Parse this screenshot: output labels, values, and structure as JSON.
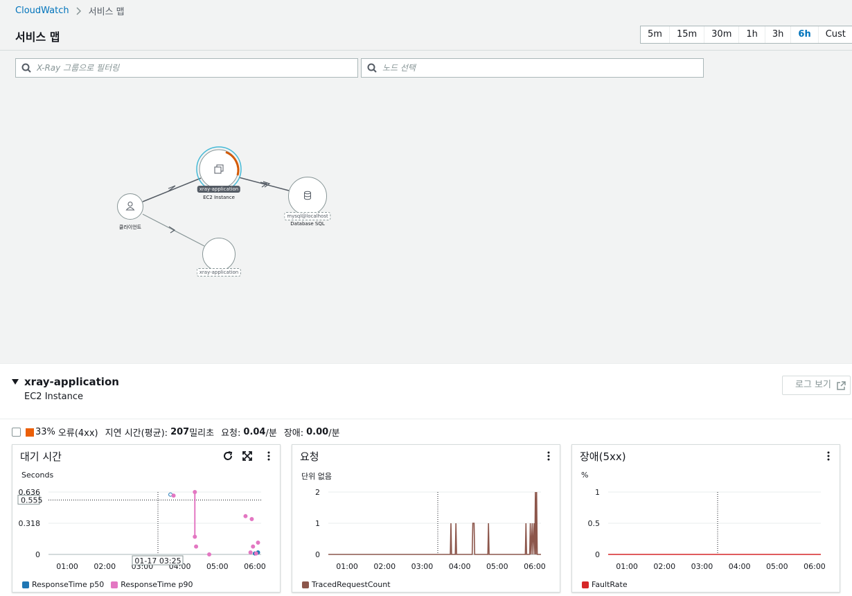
{
  "breadcrumb": {
    "root": "CloudWatch",
    "current": "서비스 맵"
  },
  "page_title": "서비스 맵",
  "time_ranges": [
    "5m",
    "15m",
    "30m",
    "1h",
    "3h",
    "6h",
    "Cust"
  ],
  "time_range_selected": "6h",
  "filters": {
    "group_placeholder": "X-Ray 그룹으로 필터링",
    "node_placeholder": "노드 선택"
  },
  "map": {
    "client_label": "클라이언트",
    "app_name": "xray-application",
    "app_type": "EC2 Instance",
    "db_name": "mysql@localhost",
    "db_type": "Database SQL",
    "remote_name": "xray-application",
    "colors": {
      "error_arc": "#d45b07",
      "selected_ring": "#44b9d6"
    }
  },
  "detail": {
    "name": "xray-application",
    "type": "EC2 Instance",
    "logs_button": "로그 보기",
    "stats": {
      "error_pct": "33%",
      "error_label": "오류(4xx)",
      "latency_label": "지연 시간(평균):",
      "latency_value": "207",
      "latency_unit": "밀리초",
      "requests_label": "요청:",
      "requests_value": "0.04",
      "requests_unit": "/분",
      "faults_label": "장애:",
      "faults_value": "0.00",
      "faults_unit": "/분",
      "error_color": "#eb5f07"
    }
  },
  "chart_data": [
    {
      "type": "scatter",
      "title": "대기 시간",
      "unit": "Seconds",
      "x_ticks": [
        "01:00",
        "02:00",
        "03:00",
        "04:00",
        "05:00",
        "06:00"
      ],
      "y_ticks": [
        "0",
        "0.318",
        "0.636"
      ],
      "ylim": [
        0,
        0.636
      ],
      "hover_time": "01-17 03:25",
      "hover_value": "0.555",
      "series": [
        {
          "name": "ResponseTime p50",
          "color": "#1f77b4",
          "points": [
            [
              "03:45",
              0.61
            ],
            [
              "06:05",
              0.02
            ],
            [
              "06:00",
              0.01
            ]
          ]
        },
        {
          "name": "ResponseTime p90",
          "color": "#e377c2",
          "points": [
            [
              "03:50",
              0.6
            ],
            [
              "04:24",
              0.636
            ],
            [
              "04:24",
              0.18
            ],
            [
              "04:26",
              0.08
            ],
            [
              "04:47",
              0.0
            ],
            [
              "05:45",
              0.39
            ],
            [
              "05:55",
              0.36
            ],
            [
              "05:57",
              0.08
            ],
            [
              "05:53",
              0.02
            ],
            [
              "06:02",
              0.01
            ],
            [
              "06:05",
              0.12
            ]
          ]
        }
      ]
    },
    {
      "type": "line",
      "title": "요청",
      "unit": "단위 없음",
      "x_ticks": [
        "01:00",
        "02:00",
        "03:00",
        "04:00",
        "05:00",
        "06:00"
      ],
      "y_ticks": [
        "0",
        "1",
        "2"
      ],
      "ylim": [
        0,
        2
      ],
      "series": [
        {
          "name": "TracedRequestCount",
          "color": "#8c564b",
          "points": [
            [
              "00:30",
              0
            ],
            [
              "03:45",
              0
            ],
            [
              "03:46",
              1
            ],
            [
              "03:47",
              0
            ],
            [
              "03:53",
              0
            ],
            [
              "03:54",
              1
            ],
            [
              "03:55",
              0
            ],
            [
              "04:20",
              0
            ],
            [
              "04:21",
              1
            ],
            [
              "04:23",
              1
            ],
            [
              "04:24",
              0
            ],
            [
              "04:45",
              0
            ],
            [
              "04:46",
              1
            ],
            [
              "04:47",
              0
            ],
            [
              "05:45",
              0
            ],
            [
              "05:46",
              1
            ],
            [
              "05:47",
              0
            ],
            [
              "05:52",
              0
            ],
            [
              "05:53",
              1
            ],
            [
              "05:54",
              0
            ],
            [
              "05:56",
              1
            ],
            [
              "05:57",
              0
            ],
            [
              "05:59",
              1
            ],
            [
              "06:00",
              0
            ],
            [
              "06:01",
              2
            ],
            [
              "06:02",
              0
            ],
            [
              "06:03",
              2
            ],
            [
              "06:04",
              0
            ],
            [
              "06:10",
              0
            ]
          ]
        }
      ]
    },
    {
      "type": "line",
      "title": "장애(5xx)",
      "unit": "%",
      "x_ticks": [
        "01:00",
        "02:00",
        "03:00",
        "04:00",
        "05:00",
        "06:00"
      ],
      "y_ticks": [
        "0",
        "0.5",
        "1"
      ],
      "ylim": [
        0,
        1
      ],
      "series": [
        {
          "name": "FaultRate",
          "color": "#d62728",
          "points": [
            [
              "00:30",
              0
            ],
            [
              "06:10",
              0
            ]
          ]
        }
      ]
    }
  ]
}
